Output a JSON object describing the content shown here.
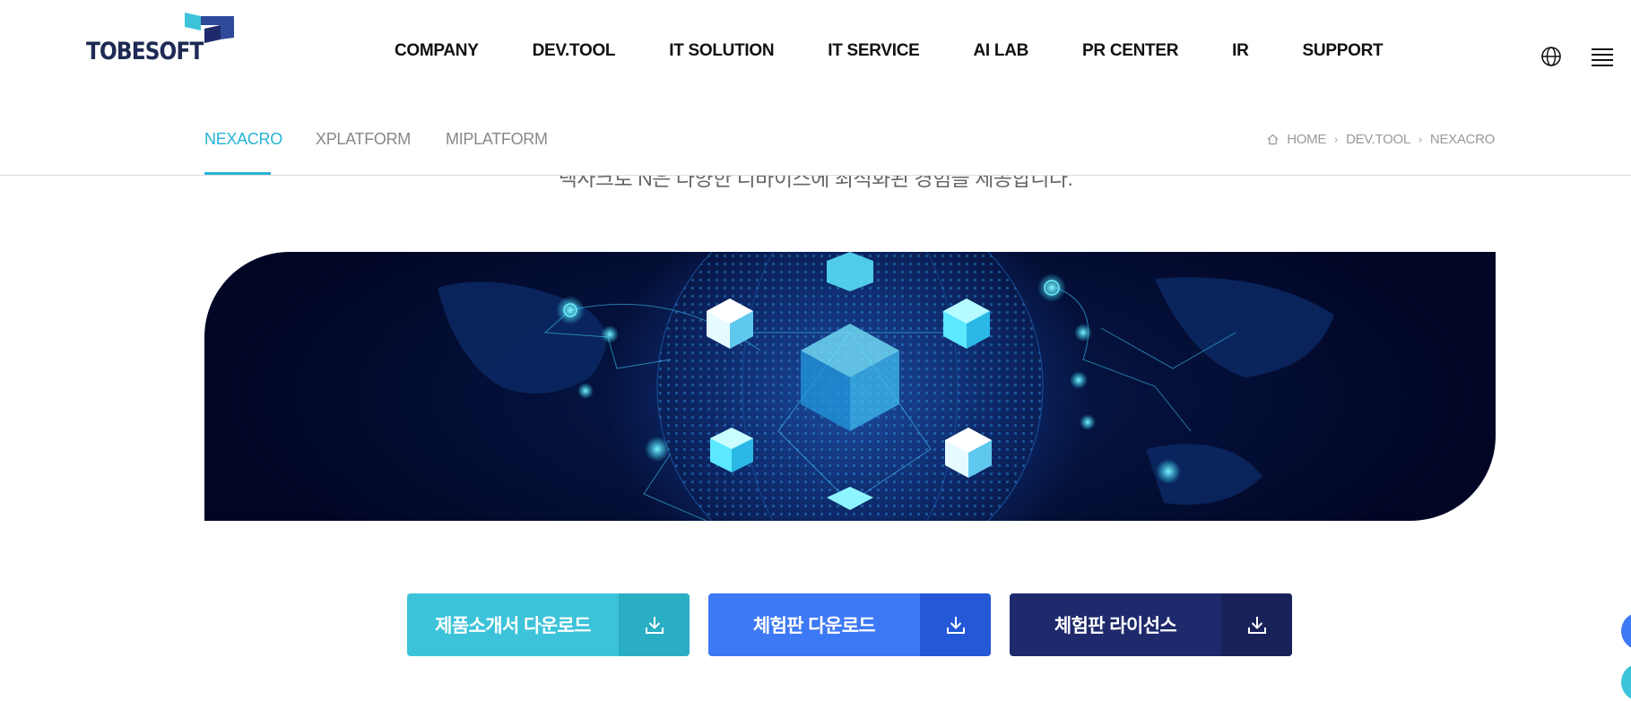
{
  "header": {
    "logo_text": "TOBESOFT",
    "nav": [
      {
        "label": "COMPANY"
      },
      {
        "label": "DEV.TOOL"
      },
      {
        "label": "IT SOLUTION"
      },
      {
        "label": "IT SERVICE"
      },
      {
        "label": "AI LAB"
      },
      {
        "label": "PR CENTER"
      },
      {
        "label": "IR"
      },
      {
        "label": "SUPPORT"
      }
    ],
    "icons": [
      "globe-icon",
      "menu-icon"
    ]
  },
  "subnav": {
    "tabs": [
      {
        "label": "NEXACRO",
        "active": true
      },
      {
        "label": "XPLATFORM",
        "active": false
      },
      {
        "label": "MIPLATFORM",
        "active": false
      }
    ],
    "breadcrumb": [
      "HOME",
      "DEV.TOOL",
      "NEXACRO"
    ]
  },
  "intro": {
    "text": "넥사크로 N은 다양한 디바이스에 최적화된 경험을 제공합니다."
  },
  "banner": {
    "description_icon": "globe-network-image"
  },
  "downloads": [
    {
      "label": "제품소개서 다운로드",
      "icon": "download-icon"
    },
    {
      "label": "체험판 다운로드",
      "icon": "download-icon"
    },
    {
      "label": "체험판 라이선스",
      "icon": "download-icon"
    }
  ],
  "colors": {
    "accent": "#27b3d6",
    "btn1": "#3cc3d9",
    "btn2": "#3d78f5",
    "btn3": "#1e2a6b",
    "navy": "#1e2a55"
  }
}
